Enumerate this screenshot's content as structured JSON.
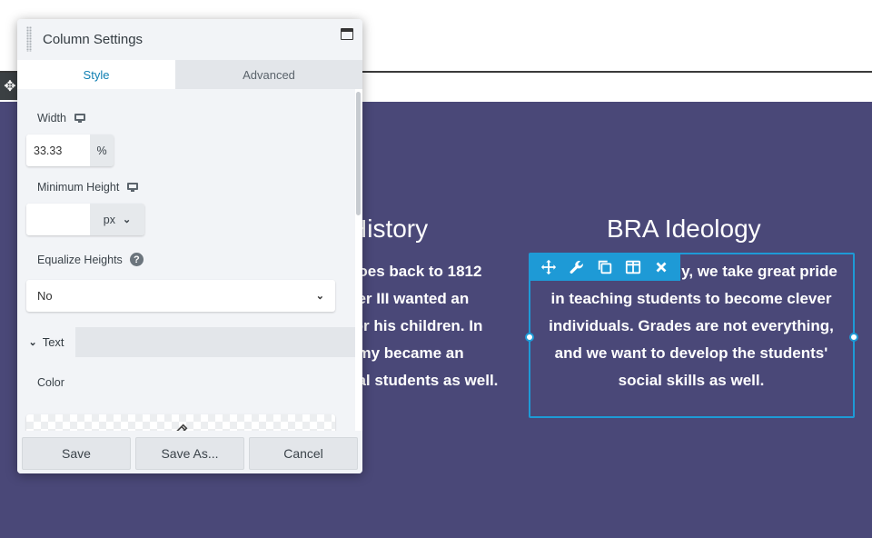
{
  "page": {
    "history": {
      "heading": "History",
      "lines": [
        "goes back to 1812",
        "ver III wanted an",
        "for his children. In",
        "emy became an",
        "val students as well."
      ]
    },
    "ideology": {
      "heading": "BRA Ideology",
      "lines": [
        "y, we take great pride",
        "in teaching students to become clever",
        "individuals. Grades are not everything,",
        "and we want to develop the students'",
        "social skills as well."
      ]
    },
    "toolbar_icons": [
      "move-icon",
      "wrench-icon",
      "duplicate-icon",
      "columns-icon",
      "close-icon"
    ]
  },
  "panel": {
    "title": "Column Settings",
    "tabs": {
      "style": "Style",
      "advanced": "Advanced"
    },
    "width": {
      "label": "Width",
      "value": "33.33",
      "unit": "%"
    },
    "min_height": {
      "label": "Minimum Height",
      "value": "",
      "unit": "px"
    },
    "equalize": {
      "label": "Equalize Heights",
      "help": "?",
      "value": "No"
    },
    "text_section": {
      "label": "Text"
    },
    "color": {
      "label": "Color"
    },
    "footer": {
      "save": "Save",
      "save_as": "Save As...",
      "cancel": "Cancel"
    }
  },
  "colors": {
    "accent": "#1e9ad6",
    "page_bg": "#4a4878",
    "tab_active": "#0f7fb2"
  }
}
